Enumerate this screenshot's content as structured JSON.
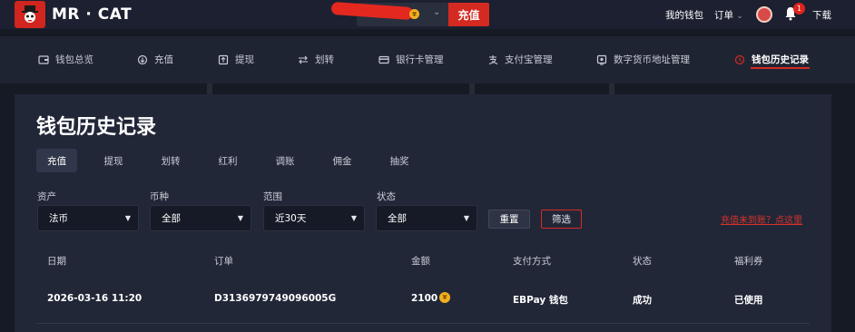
{
  "header": {
    "brand": "MR · CAT",
    "deposit_label": "充值",
    "wallet_link": "我的钱包",
    "orders_link": "订单",
    "orders_caret": "⌄",
    "notification_count": "1",
    "download_link": "下载"
  },
  "subnav": {
    "items": [
      {
        "label": "钱包总览",
        "icon": "wallet-icon"
      },
      {
        "label": "充值",
        "icon": "deposit-icon"
      },
      {
        "label": "提现",
        "icon": "withdraw-icon"
      },
      {
        "label": "划转",
        "icon": "transfer-icon"
      },
      {
        "label": "银行卡管理",
        "icon": "bank-card-icon"
      },
      {
        "label": "支付宝管理",
        "icon": "alipay-icon"
      },
      {
        "label": "数字货币地址管理",
        "icon": "crypto-address-icon"
      },
      {
        "label": "钱包历史记录",
        "icon": "history-icon"
      }
    ],
    "active_index": 7
  },
  "page": {
    "title": "钱包历史记录",
    "tabs": [
      "充值",
      "提现",
      "划转",
      "红利",
      "调账",
      "佣金",
      "抽奖"
    ],
    "active_tab": 0
  },
  "filters": {
    "asset": {
      "label": "资产",
      "value": "法币"
    },
    "currency": {
      "label": "币种",
      "value": "全部"
    },
    "range": {
      "label": "范围",
      "value": "近30天"
    },
    "status": {
      "label": "状态",
      "value": "全部"
    },
    "reset_label": "重置",
    "filter_label": "筛选",
    "help_link": "充值未到账？点这里"
  },
  "table": {
    "columns": [
      "日期",
      "订单",
      "金额",
      "支付方式",
      "状态",
      "福利券"
    ],
    "rows": [
      {
        "date": "2026-03-16 11:20",
        "order": "D3136979749096005G",
        "amount": "2100",
        "payment": "EBPay 钱包",
        "status": "成功",
        "coupon": "已使用"
      }
    ]
  },
  "colors": {
    "accent": "#d52a22",
    "coin": "#f2b01e",
    "background": "#161a24",
    "panel": "#222738"
  },
  "icons": {
    "coin": "coin-icon",
    "bell": "bell-icon",
    "dropdown": "chevron-down-icon"
  }
}
